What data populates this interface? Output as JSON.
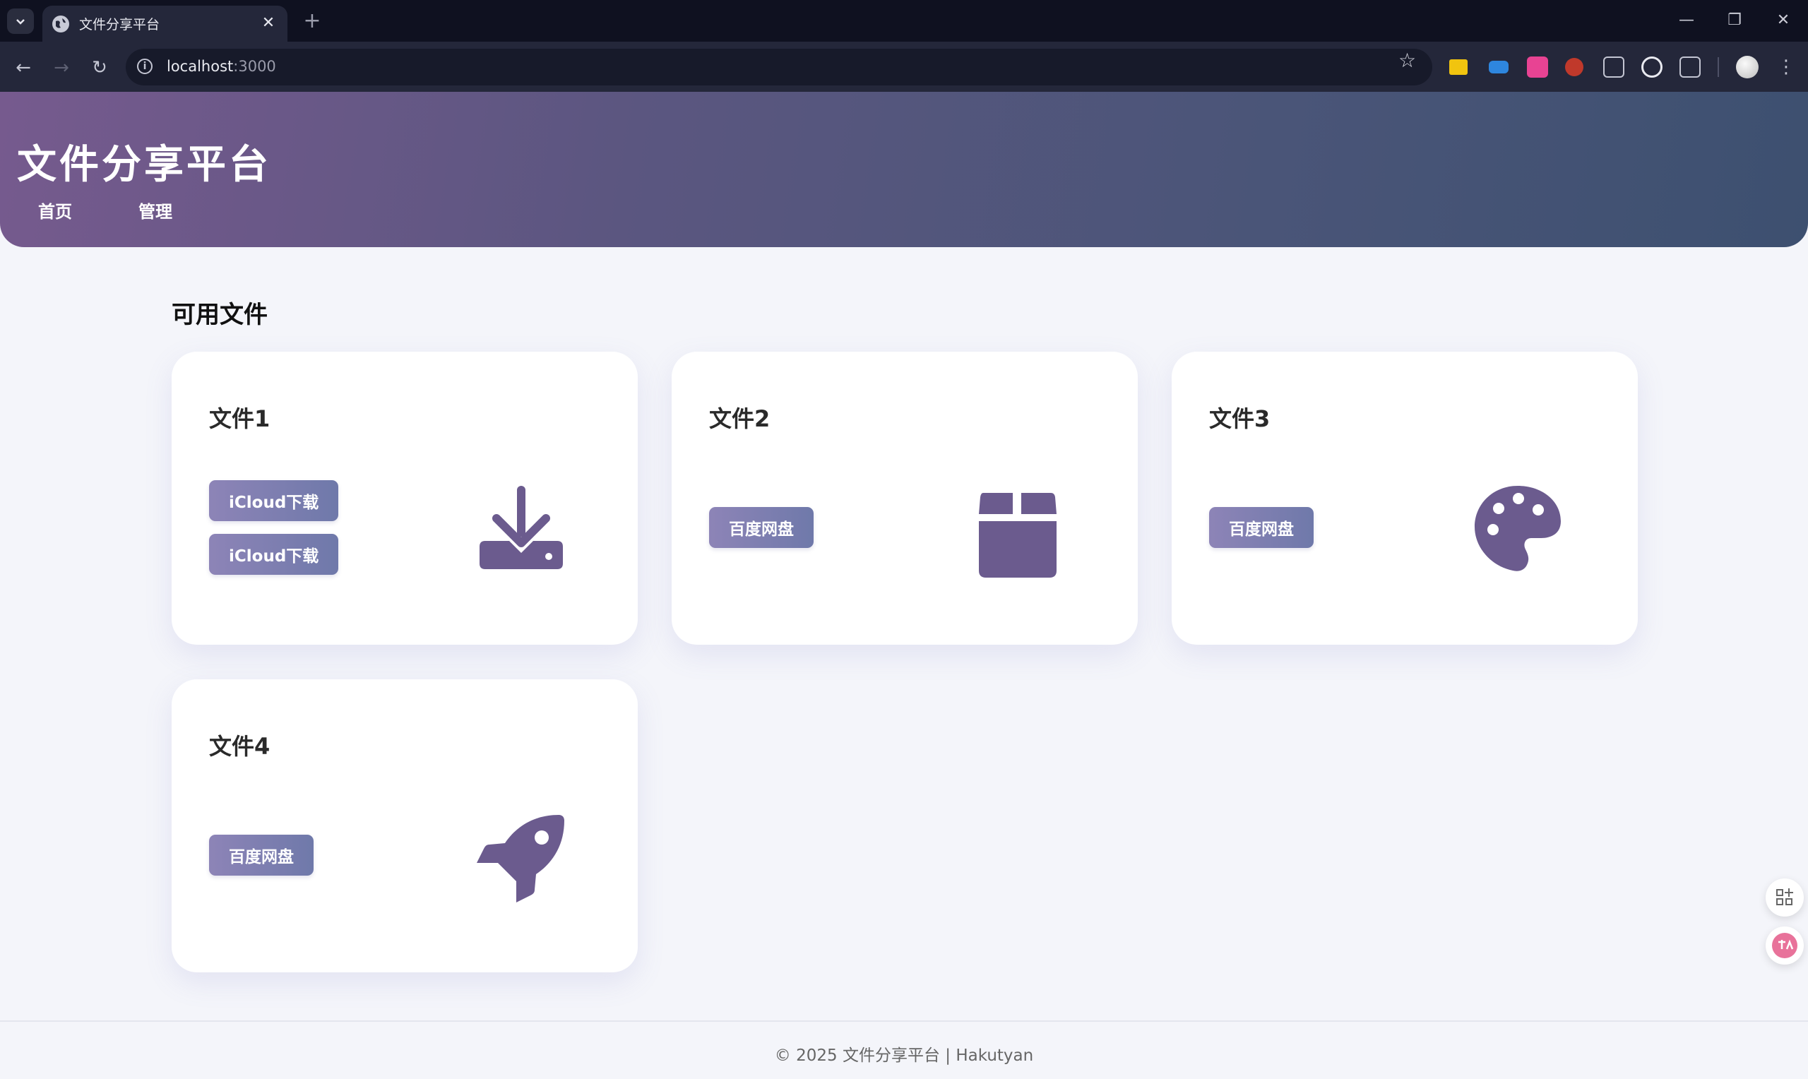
{
  "browser": {
    "tab_title": "文件分享平台",
    "url_host": "localhost",
    "url_port": ":3000",
    "tab_close": "✕",
    "new_tab": "+"
  },
  "header": {
    "title": "文件分享平台",
    "nav": [
      "首页",
      "管理"
    ]
  },
  "section": {
    "title": "可用文件"
  },
  "files": [
    {
      "name": "文件1",
      "buttons": [
        "iCloud下载",
        "iCloud下载"
      ],
      "icon": "download-icon"
    },
    {
      "name": "文件2",
      "buttons": [
        "百度网盘"
      ],
      "icon": "box-icon"
    },
    {
      "name": "文件3",
      "buttons": [
        "百度网盘"
      ],
      "icon": "palette-icon"
    },
    {
      "name": "文件4",
      "buttons": [
        "百度网盘"
      ],
      "icon": "rocket-icon"
    }
  ],
  "footer": {
    "text": "© 2025 文件分享平台 | Hakutyan"
  },
  "colors": {
    "header_gradient_start": "#765a8e",
    "header_gradient_end": "#3d5070",
    "icon_color": "#6b5b8e",
    "button_gradient_start": "#8d84b7",
    "button_gradient_end": "#6f79aa"
  }
}
